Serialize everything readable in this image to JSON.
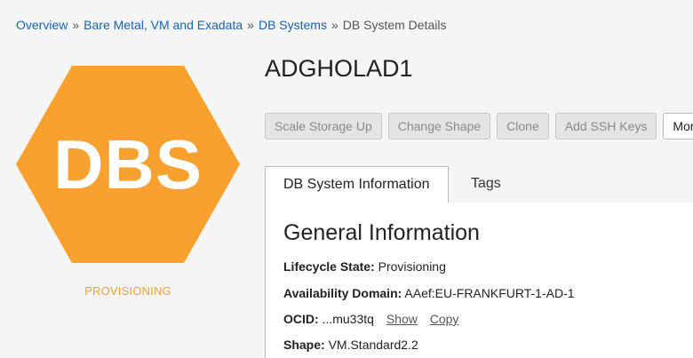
{
  "breadcrumb": {
    "items": [
      "Overview",
      "Bare Metal, VM and Exadata",
      "DB Systems"
    ],
    "current": "DB System Details",
    "separator": "»"
  },
  "resource": {
    "icon_text": "DBS",
    "icon_color": "#f9a12f",
    "status": "PROVISIONING",
    "status_color": "#f0a030",
    "name": "ADGHOLAD1"
  },
  "actions": {
    "scale_storage": "Scale Storage Up",
    "change_shape": "Change Shape",
    "clone": "Clone",
    "add_ssh_keys": "Add SSH Keys",
    "more": "More"
  },
  "tabs": {
    "info": "DB System Information",
    "tags": "Tags"
  },
  "general": {
    "title": "General Information",
    "lifecycle_label": "Lifecycle State:",
    "lifecycle_value": "Provisioning",
    "ad_label": "Availability Domain:",
    "ad_value": "AAef:EU-FRANKFURT-1-AD-1",
    "ocid_label": "OCID:",
    "ocid_value": "...mu33tq",
    "show_link": "Show",
    "copy_link": "Copy",
    "shape_label": "Shape:",
    "shape_value": "VM.Standard2.2"
  }
}
